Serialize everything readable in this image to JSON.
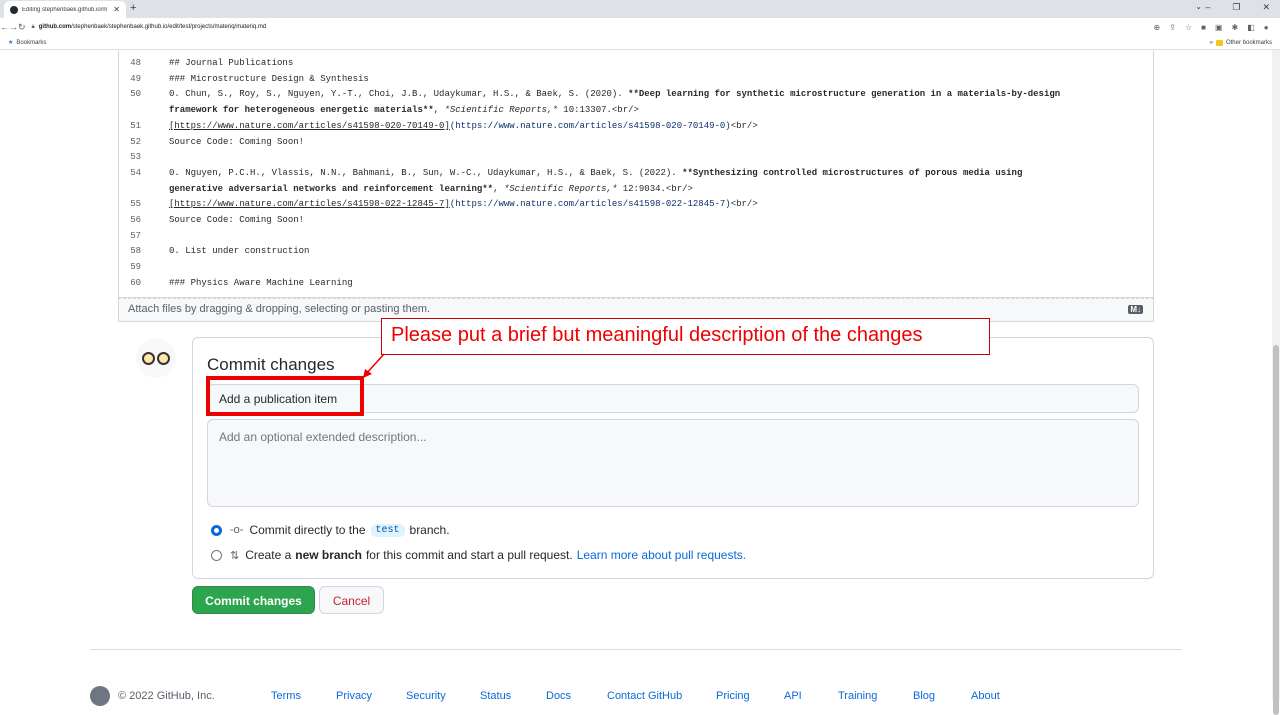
{
  "browser": {
    "tab_title": "Editing stephenbaek.github.io/m",
    "url_host": "github.com",
    "url_path": "/stephenbaek/stephenbaek.github.io/edit/test/projects/materiq/materiq.md",
    "bookmarks_label": "Bookmarks",
    "other_bookmarks": "Other bookmarks"
  },
  "editor": {
    "lines": [
      {
        "n": "48",
        "text": "## Journal Publications"
      },
      {
        "n": "49",
        "text": "### Microstructure Design & Synthesis"
      },
      {
        "n": "50",
        "pre": "0. Chun, S., Roy, S., Nguyen, Y.-T., Choi, J.B., Udaykumar, H.S., & Baek, S. (2020). ",
        "bold": "**Deep learning for synthetic microstructure generation in a materials-by-design"
      },
      {
        "n": "",
        "bold": "framework for heterogeneous energetic materials**",
        "mid": ", ",
        "ital": "*Scientific Reports,*",
        "post": " 10:13307.<br/>"
      },
      {
        "n": "51",
        "link": "[https://www.nature.com/articles/s41598-020-70149-0]",
        "url": "(https://www.nature.com/articles/s41598-020-70149-0)",
        "post": "<br/>"
      },
      {
        "n": "52",
        "text": "Source Code: Coming Soon!"
      },
      {
        "n": "53",
        "text": ""
      },
      {
        "n": "54",
        "pre": "0. Nguyen, P.C.H., Vlassis, N.N., Bahmani, B., Sun, W.-C., Udaykumar, H.S., & Baek, S. (2022). ",
        "bold": "**Synthesizing controlled microstructures of porous media using"
      },
      {
        "n": "",
        "bold": "generative adversarial networks and reinforcement learning**",
        "mid": ", ",
        "ital": "*Scientific Reports,*",
        "post": " 12:9034.<br/>"
      },
      {
        "n": "55",
        "link": "[https://www.nature.com/articles/s41598-022-12845-7]",
        "url": "(https://www.nature.com/articles/s41598-022-12845-7)",
        "post": "<br/>"
      },
      {
        "n": "56",
        "text": "Source Code: Coming Soon!"
      },
      {
        "n": "57",
        "text": ""
      },
      {
        "n": "58",
        "text": "0. List under construction"
      },
      {
        "n": "59",
        "text": ""
      },
      {
        "n": "60",
        "text": "### Physics Aware Machine Learning"
      }
    ],
    "attach_hint": "Attach files by dragging & dropping, selecting or pasting them.",
    "md_badge": "M↓"
  },
  "commit": {
    "title": "Commit changes",
    "summary_value": "Add a publication item",
    "description_placeholder": "Add an optional extended description...",
    "option_direct_pre": "Commit directly to the",
    "branch_name": "test",
    "option_direct_post": "branch.",
    "option_new_pre": "Create a",
    "option_new_bold": "new branch",
    "option_new_post": "for this commit and start a pull request.",
    "option_new_link": "Learn more about pull requests.",
    "commit_button": "Commit changes",
    "cancel_button": "Cancel"
  },
  "annotation": {
    "callout": "Please put a brief but meaningful description of the changes",
    "color": "#ee0000"
  },
  "footer": {
    "copyright": "© 2022 GitHub, Inc.",
    "links": [
      "Terms",
      "Privacy",
      "Security",
      "Status",
      "Docs",
      "Contact GitHub",
      "Pricing",
      "API",
      "Training",
      "Blog",
      "About"
    ]
  }
}
